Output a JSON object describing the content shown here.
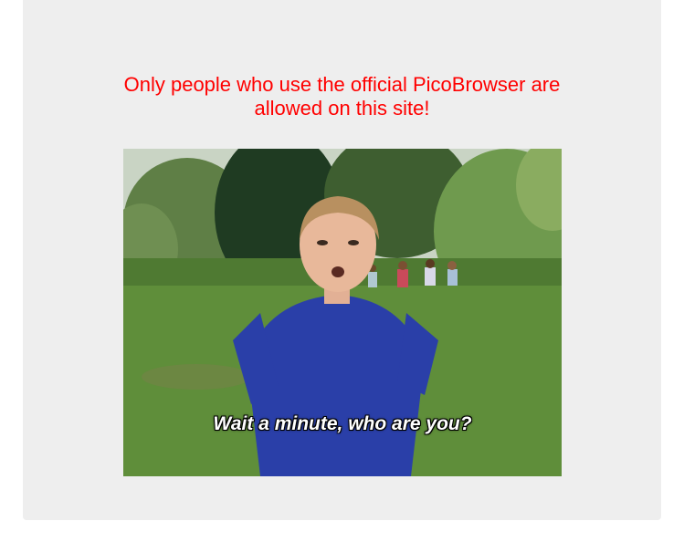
{
  "message": {
    "line1": "Only people who use the official PicoBrowser are",
    "line2": "allowed on this site!",
    "color": "#ff0000"
  },
  "image": {
    "caption": "Wait a minute, who are you?"
  },
  "colors": {
    "panel_background": "#eeeeee",
    "page_background": "#ffffff"
  }
}
